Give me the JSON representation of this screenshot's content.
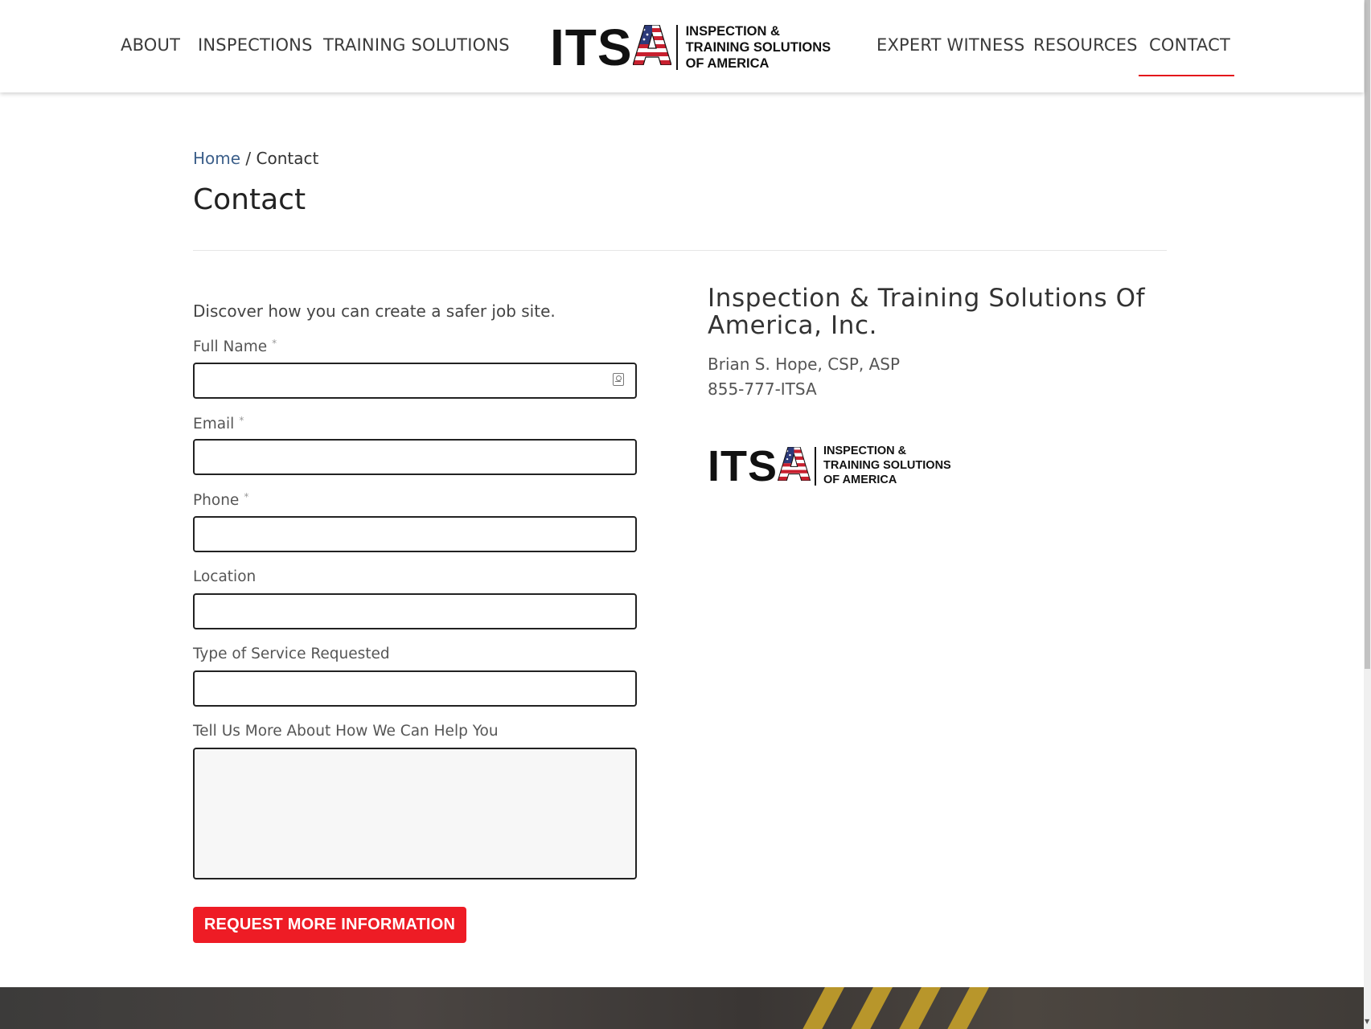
{
  "nav": {
    "left": [
      "ABOUT",
      "INSPECTIONS",
      "TRAINING SOLUTIONS"
    ],
    "right": [
      "EXPERT WITNESS",
      "RESOURCES",
      "CONTACT"
    ],
    "active": "CONTACT",
    "active_color": "#e4161b"
  },
  "logo": {
    "letters": "ITS",
    "flag_letter": "A",
    "tagline": [
      "INSPECTION &",
      "TRAINING SOLUTIONS",
      "OF AMERICA"
    ]
  },
  "breadcrumb": {
    "home": "Home",
    "separator": " / ",
    "current": "Contact"
  },
  "page_title": "Contact",
  "form": {
    "intro": "Discover how you can create a safer job site.",
    "fields": {
      "full_name": {
        "label": "Full Name",
        "required_mark": "*",
        "value": ""
      },
      "email": {
        "label": "Email",
        "required_mark": "*",
        "value": ""
      },
      "phone": {
        "label": "Phone",
        "required_mark": "*",
        "value": ""
      },
      "location": {
        "label": "Location",
        "value": ""
      },
      "service_type": {
        "label": "Type of Service Requested",
        "value": ""
      },
      "message": {
        "label": "Tell Us More About How We Can Help You",
        "value": ""
      }
    },
    "submit_label": "REQUEST MORE INFORMATION",
    "submit_color": "#ee1c25"
  },
  "company": {
    "name": "Inspection & Training Solutions Of America, Inc.",
    "contact_person": "Brian S. Hope, CSP, ASP",
    "phone": "855-777-ITSA"
  },
  "icons": {
    "autofill": "contact-card-icon"
  }
}
